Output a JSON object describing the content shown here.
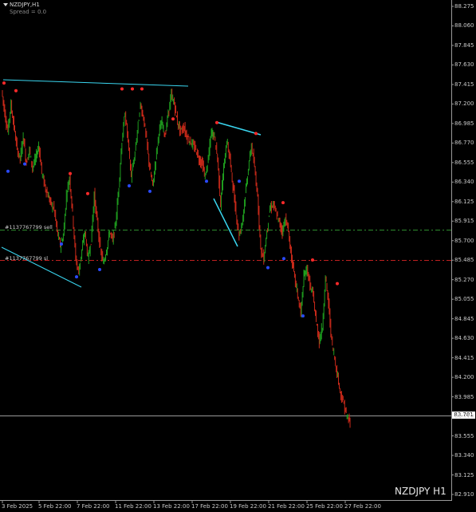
{
  "header": {
    "symbol": "NZDJPY,H1",
    "spread": "Spread = 0.0"
  },
  "watermark": "NZDJPY H1",
  "orders": {
    "sell_label": "#1137767799 sell",
    "sl_label": "#1137767799 sl"
  },
  "current_price": "83.781",
  "chart_data": {
    "type": "candlestick",
    "symbol": "NZDJPY",
    "timeframe": "H1",
    "y_ticks": [
      "88.275",
      "88.060",
      "87.845",
      "87.630",
      "87.415",
      "87.200",
      "86.985",
      "86.770",
      "86.555",
      "86.340",
      "86.125",
      "85.915",
      "85.700",
      "85.485",
      "85.270",
      "85.055",
      "84.845",
      "84.630",
      "84.415",
      "84.200",
      "83.985",
      "83.770",
      "83.555",
      "83.340",
      "83.125",
      "82.910"
    ],
    "x_ticks": [
      "3 Feb 2025",
      "5 Feb 22:00",
      "7 Feb 22:00",
      "11 Feb 22:00",
      "13 Feb 22:00",
      "17 Feb 22:00",
      "19 Feb 22:00",
      "21 Feb 22:00",
      "25 Feb 22:00",
      "27 Feb 22:00"
    ],
    "ylim": [
      82.91,
      88.275
    ],
    "order_levels": {
      "sell": 85.8,
      "sl": 85.485
    },
    "price_path": [
      87.35,
      87.1,
      86.9,
      87.2,
      86.95,
      86.7,
      86.6,
      86.85,
      86.55,
      86.7,
      86.5,
      86.6,
      86.75,
      86.45,
      86.3,
      86.2,
      86.1,
      86.05,
      85.8,
      85.65,
      85.75,
      86.2,
      86.4,
      86.0,
      85.5,
      85.35,
      85.6,
      85.8,
      85.5,
      85.7,
      86.2,
      85.9,
      85.6,
      85.45,
      85.6,
      85.8,
      85.7,
      85.9,
      86.3,
      86.8,
      87.1,
      86.8,
      86.4,
      86.6,
      86.9,
      87.2,
      87.05,
      86.8,
      86.5,
      86.3,
      86.6,
      86.9,
      87.0,
      86.85,
      87.1,
      87.3,
      87.2,
      87.0,
      86.9,
      86.95,
      86.85,
      86.8,
      86.75,
      86.7,
      86.6,
      86.55,
      86.4,
      86.6,
      86.9,
      86.85,
      86.6,
      86.1,
      86.5,
      86.8,
      86.6,
      86.3,
      86.0,
      85.75,
      85.9,
      86.2,
      86.5,
      86.75,
      86.5,
      86.2,
      85.6,
      85.5,
      85.8,
      86.05,
      86.1,
      86.0,
      85.9,
      85.8,
      85.95,
      85.8,
      85.5,
      85.3,
      85.1,
      84.9,
      85.3,
      85.4,
      85.2,
      85.1,
      84.8,
      84.6,
      84.75,
      85.3,
      85.0,
      84.6,
      84.4,
      84.2,
      84.0,
      83.9,
      83.75,
      83.7
    ],
    "fractals_up": [
      87.415,
      87.33,
      86.42,
      86.2,
      87.35,
      87.35,
      87.35,
      87.02,
      86.98,
      86.86,
      86.1,
      85.47,
      85.21
    ],
    "fractals_down": [
      86.48,
      86.56,
      85.68,
      85.32,
      85.4,
      86.32,
      86.26,
      86.37,
      86.37,
      85.42,
      85.52,
      84.89
    ]
  }
}
